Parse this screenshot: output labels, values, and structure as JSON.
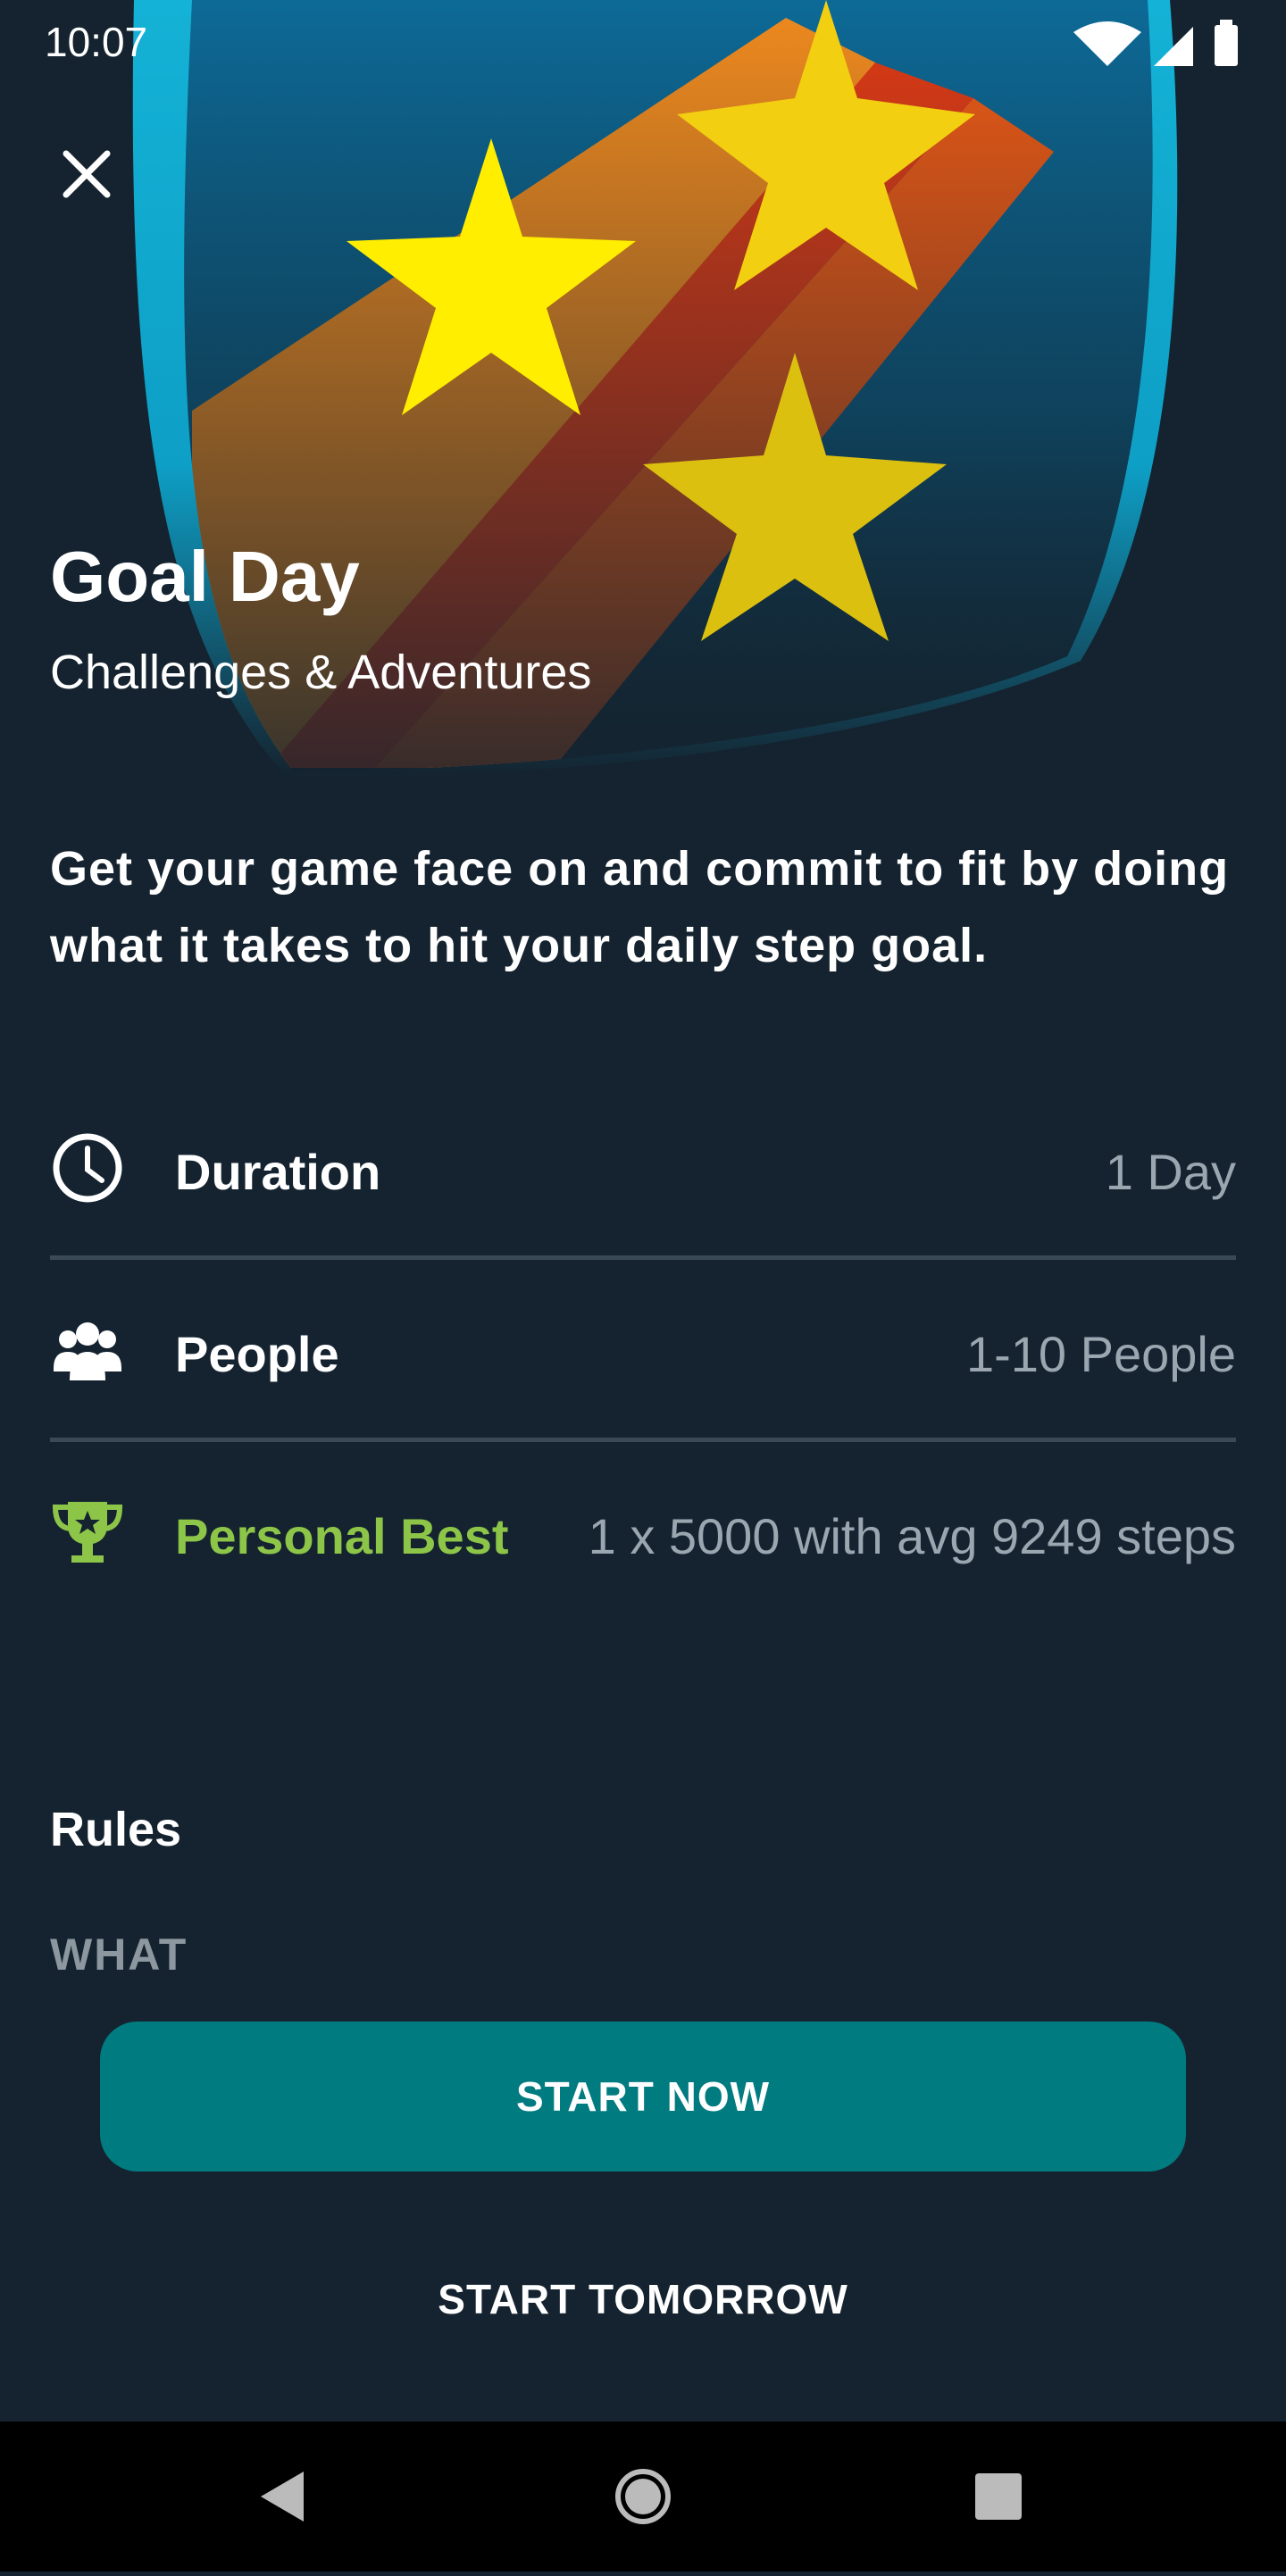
{
  "status_bar": {
    "time": "10:07"
  },
  "header": {
    "title": "Goal Day",
    "subtitle": "Challenges & Adventures"
  },
  "description": "Get your game face on and commit to fit by doing what it takes to hit your daily step goal.",
  "details": [
    {
      "icon": "clock-icon",
      "label": "Duration",
      "value": "1 Day"
    },
    {
      "icon": "people-icon",
      "label": "People",
      "value": "1-10 People"
    },
    {
      "icon": "trophy-icon",
      "label": "Personal Best",
      "value": "1 x 5000 with avg 9249 steps"
    }
  ],
  "rules": {
    "heading": "Rules",
    "what_label": "WHAT"
  },
  "buttons": {
    "start_now": "START NOW",
    "start_tomorrow": "START TOMORROW"
  },
  "colors": {
    "background": "#14232f",
    "accent_teal": "#007b80",
    "personal_best_green": "#8dc549"
  }
}
